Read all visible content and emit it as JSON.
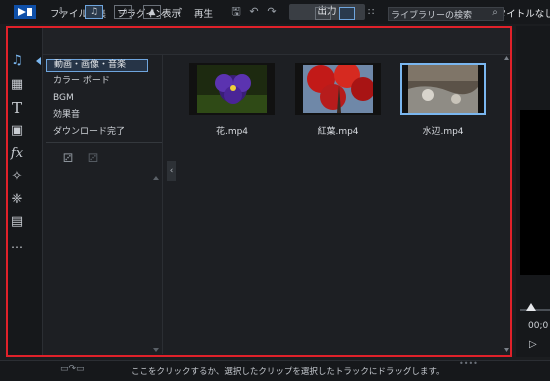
{
  "menu": {
    "items": [
      "ファイル",
      "編集",
      "プラグイン",
      "表示",
      "再生"
    ],
    "output_label": "出力",
    "project_title": "新規プロジェクト (タイトルなし)*"
  },
  "toolbar": {
    "search_placeholder": "ライブラリーの検索"
  },
  "categories": [
    {
      "label": "動画・画像・音楽",
      "selected": true
    },
    {
      "label": "カラー ボード",
      "selected": false
    },
    {
      "label": "BGM",
      "selected": false
    },
    {
      "label": "効果音",
      "selected": false
    },
    {
      "label": "ダウンロード完了",
      "selected": false
    }
  ],
  "media": [
    {
      "caption": "花.mp4",
      "icon": "flower-thumbnail",
      "selected": false
    },
    {
      "caption": "紅葉.mp4",
      "icon": "autumn-leaves-thumbnail",
      "selected": false
    },
    {
      "caption": "水辺.mp4",
      "icon": "waterside-thumbnail",
      "selected": true
    }
  ],
  "preview": {
    "timecode": "00;0"
  },
  "status": {
    "hint": "ここをクリックするか、選択したクリップを選択したトラックにドラッグします。"
  },
  "colors": {
    "highlight_frame": "#e0212a",
    "accent": "#6fa5dd",
    "background": "#1b1d20"
  }
}
